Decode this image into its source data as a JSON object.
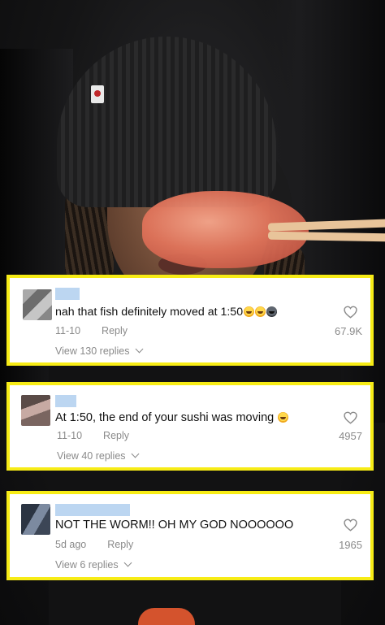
{
  "comments": [
    {
      "text": "nah that fish definitely moved at 1:50",
      "emojis": [
        "loudly-crying-face",
        "loudly-crying-face",
        "skull-face"
      ],
      "date": "11-10",
      "reply_label": "Reply",
      "view_replies": "View 130 replies",
      "likes": "67.9K"
    },
    {
      "text": "At 1:50, the end of your sushi was moving",
      "emojis": [
        "loudly-crying-face"
      ],
      "date": "11-10",
      "reply_label": "Reply",
      "view_replies": "View 40 replies",
      "likes": "4957"
    },
    {
      "text": "NOT THE WORM!! OH MY GOD NOOOOOO",
      "emojis": [],
      "date": "5d ago",
      "reply_label": "Reply",
      "view_replies": "View 6 replies",
      "likes": "1965"
    }
  ],
  "colors": {
    "card_border": "#f7ec16",
    "username_placeholder": "#bcd6f1",
    "meta_text": "#8a8a8a"
  }
}
